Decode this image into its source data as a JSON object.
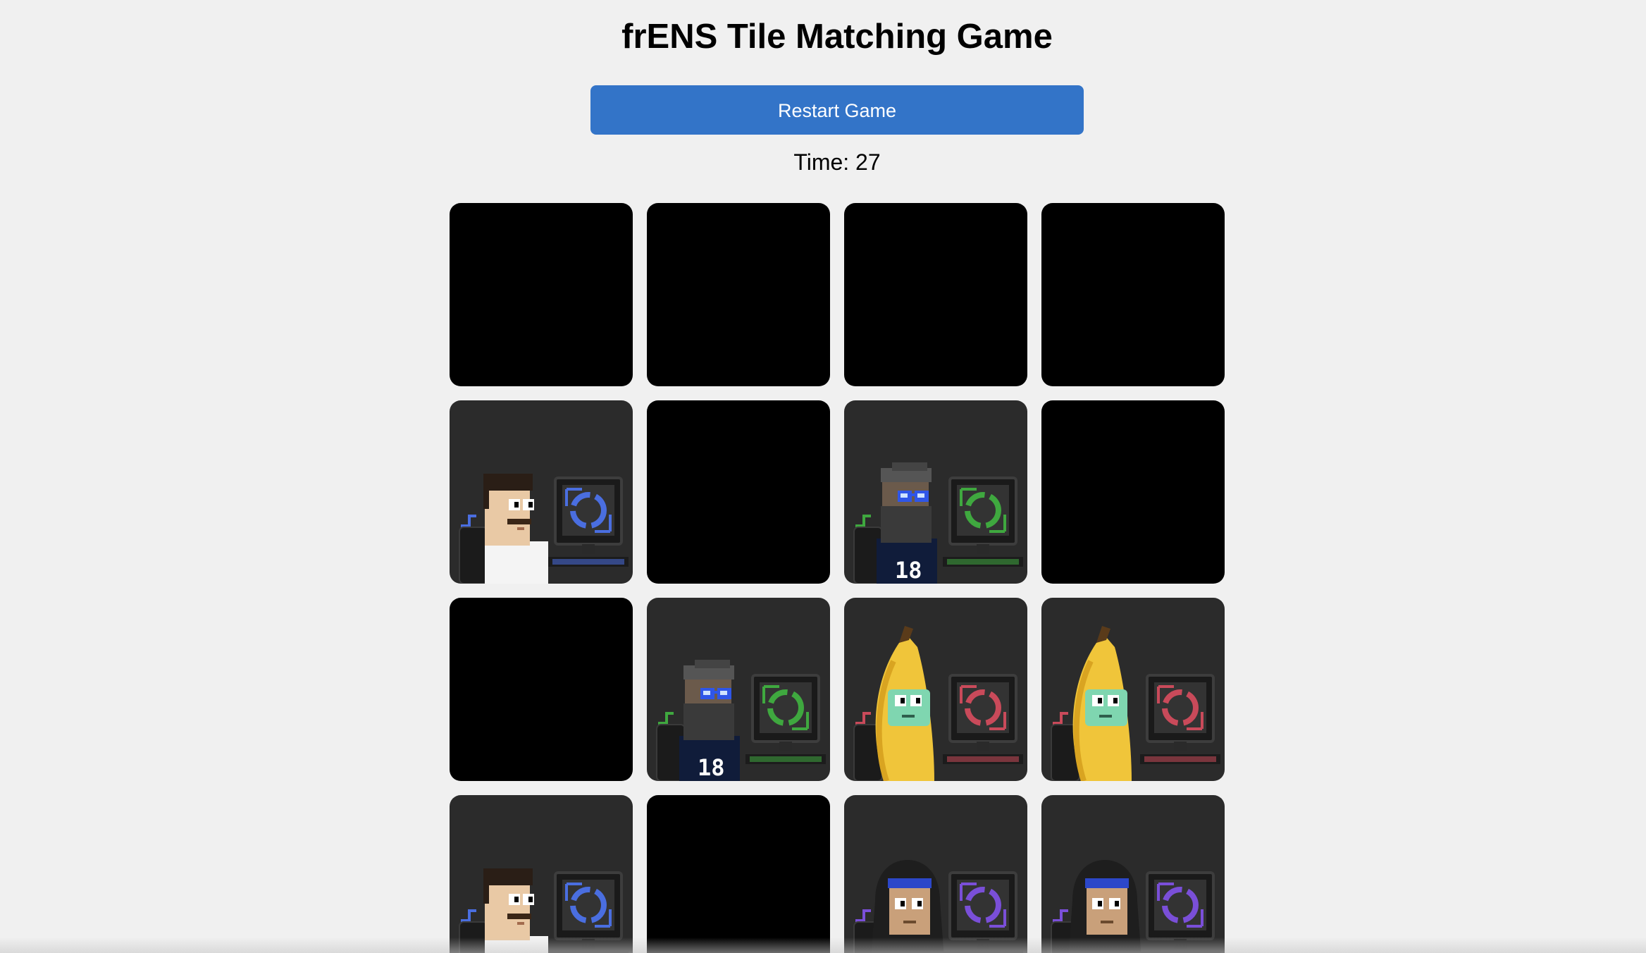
{
  "game": {
    "title": "frENS Tile Matching Game",
    "restart_label": "Restart Game",
    "timer_label": "Time:",
    "timer_value": "27",
    "timer_text": "Time: 27",
    "tile_back_color": "#000000",
    "tile_face_color": "#2b2b2b",
    "button_color": "#3374c8"
  },
  "board": {
    "columns": 4,
    "visible_rows": 4,
    "tiles": [
      {
        "state": "hidden"
      },
      {
        "state": "hidden"
      },
      {
        "state": "hidden"
      },
      {
        "state": "hidden"
      },
      {
        "state": "revealed",
        "character": "mustache-man",
        "theme_color": "#4a6ee0"
      },
      {
        "state": "hidden"
      },
      {
        "state": "revealed",
        "character": "bearded-man-jersey-18",
        "theme_color": "#3fa83f"
      },
      {
        "state": "hidden"
      },
      {
        "state": "hidden"
      },
      {
        "state": "revealed",
        "character": "bearded-man-jersey-18",
        "theme_color": "#3fa83f"
      },
      {
        "state": "revealed",
        "character": "banana",
        "theme_color": "#c94a5a"
      },
      {
        "state": "revealed",
        "character": "banana",
        "theme_color": "#c94a5a"
      },
      {
        "state": "revealed",
        "character": "mustache-man",
        "theme_color": "#4a6ee0"
      },
      {
        "state": "hidden"
      },
      {
        "state": "revealed",
        "character": "hooded-person",
        "theme_color": "#7a4fd8"
      },
      {
        "state": "revealed",
        "character": "hooded-person",
        "theme_color": "#7a4fd8"
      }
    ]
  }
}
